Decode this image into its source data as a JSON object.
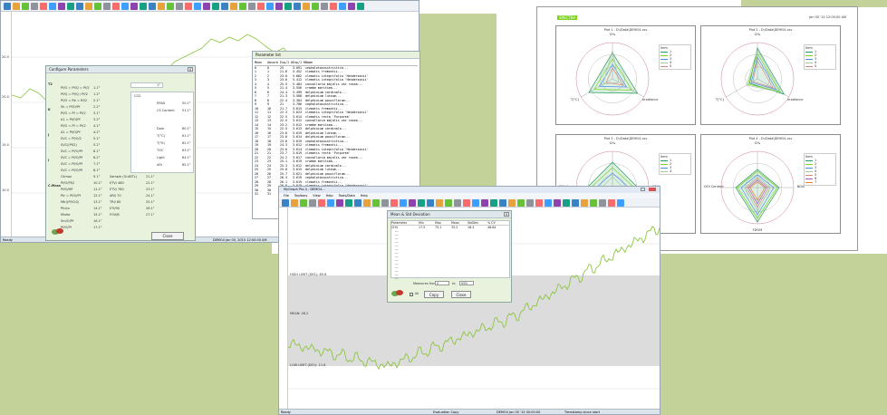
{
  "colors": {
    "background_green": "#c2d299",
    "trace_green": "#8cc63f",
    "dialog_fill": "#e9f2dd",
    "shaded_band": "#dcdcdc",
    "radar_green": "#1f9d55"
  },
  "main_window": {
    "ready_label": "Ready",
    "status_text": "DEMO4  Jan 05, 2015 12:00:00 AM",
    "y_ticks": [
      "20.0",
      "20.0",
      "15.0",
      "10.0",
      "5.0"
    ]
  },
  "config_dialog": {
    "title": "Configure Parameters",
    "close_label": "Close",
    "blank_value": "1°",
    "section_labels": [
      "T2",
      "K",
      "J",
      "I",
      "C.Mass"
    ],
    "left_rows": [
      "Pf/O = Pf/Q = Pf/2",
      "Pf/Q = Pf/Q / Pf/2",
      "Pf/O = Rk = Rf/2",
      "Sk = Pf/O/Pf",
      "Pf/O = Pf = Pf/2",
      "A1 = Pf/O/Pf",
      "Pf/O = Pf = Pf/2",
      "A1 = Pf/O/Pf",
      "SVC = Pf/O/2",
      "SVC/(Pf/2)",
      "SVC = Pf/O/Pf",
      "SVC = Pf/O/Pf",
      "SVC = Pf/O/Pf",
      "SVC = Pf/O/Pf",
      "Climax",
      "Pf/O/Pf/2",
      "Pf/O/MF",
      "Ptr = Pf/O/Pf",
      "Mtr/(Pf/O/2)",
      "Ptr/ra",
      "Mixfor",
      "Sm/O/Pf",
      "Pf/O/Pf"
    ],
    "left_values": [
      "1.1°",
      "1.2°",
      "2.1°",
      "2.2°",
      "3.1°",
      "3.2°",
      "4.1°",
      "4.2°",
      "5.1°",
      "5.2°",
      "6.1°",
      "6.2°",
      "7.1°",
      "8.1°",
      "9.1°",
      "10.1°",
      "11.1°",
      "12.1°",
      "13.1°",
      "14.1°",
      "15.1°",
      "16.1°",
      "17.1°"
    ],
    "right_top_label": "CO2",
    "right_rows": [
      "EPAD",
      "CS Content",
      "Dark",
      "T(°C)",
      "T(°K)",
      "TOC",
      "Light",
      "ARI"
    ],
    "right_values": [
      "50.1°",
      "51.1°",
      "60.1°",
      "61.1°",
      "62.1°",
      "63.1°",
      "64.1°",
      "65.1°"
    ],
    "bottom_rows": [
      "Sample (OutDTL)",
      "ETV/ 480",
      "ETV/ 780",
      "ARI/ 70",
      "TRI/ 80",
      "ETI/90",
      "FOV/B"
    ],
    "bottom_values": [
      "21.1°",
      "22.1°",
      "23.1°",
      "24.1°",
      "25.1°",
      "26.1°",
      "27.1°"
    ]
  },
  "param_list": {
    "title": "Parameter list",
    "headers": [
      "Mean",
      "Absorb",
      "Exp/1 Obj",
      "Exp/1 RGPD",
      "Name"
    ],
    "rows": [
      [
        "0",
        "0",
        "25",
        "3.091",
        "cephalotaxusstrictica..."
      ],
      [
        "1",
        "1",
        "21.6",
        "3.452",
        "clematis fremontii..."
      ],
      [
        "2",
        "2",
        "23.0",
        "5.662",
        "clematis integrifolia 'Hendersonii'"
      ],
      [
        "3",
        "3",
        "23.6",
        "5.412",
        "clematis integrifolia 'Hendersonii'"
      ],
      [
        "4",
        "4",
        "25.5",
        "5.484",
        "convallaria majalis var rosea..."
      ],
      [
        "5",
        "5",
        "21.4",
        "3.556",
        "crambe maritima..."
      ],
      [
        "6",
        "6",
        "24.4",
        "3.499",
        "delphinium cardinale..."
      ],
      [
        "7",
        "7",
        "21.3",
        "3.568",
        "delphinium luteum..."
      ],
      [
        "8",
        "8",
        "22.4",
        "3.304",
        "delphinium pauciflorum..."
      ],
      [
        "9",
        "9",
        "21",
        "3.706",
        "cephalotaxusstrictica..."
      ],
      [
        "10",
        "10",
        "21.7",
        "3.615",
        "clematis fremontii..."
      ],
      [
        "11",
        "11",
        "22.3",
        "3.623",
        "clematis integrifolia 'Hendersonii'"
      ],
      [
        "12",
        "12",
        "22.5",
        "3.614",
        "clematis recta 'Purpurea'"
      ],
      [
        "13",
        "13",
        "22.5",
        "3.612",
        "convallaria majalis var rosea..."
      ],
      [
        "14",
        "14",
        "23.2",
        "3.612",
        "crambe maritima..."
      ],
      [
        "15",
        "15",
        "22.5",
        "3.613",
        "delphinium cardinale..."
      ],
      [
        "16",
        "16",
        "23.6",
        "3.619",
        "delphinium luteum..."
      ],
      [
        "17",
        "17",
        "23.8",
        "3.614",
        "delphinium pauciflorum..."
      ],
      [
        "18",
        "18",
        "23.6",
        "3.619",
        "cephalotaxusstrictica..."
      ],
      [
        "19",
        "19",
        "24.3",
        "3.612",
        "clematis fremontii..."
      ],
      [
        "20",
        "20",
        "23.6",
        "3.614",
        "clematis integrifolia 'Hendersonii'"
      ],
      [
        "21",
        "21",
        "23.7",
        "3.619",
        "clematis recta 'Purpurea'"
      ],
      [
        "22",
        "22",
        "24.2",
        "3.617",
        "convallaria majalis var rosea..."
      ],
      [
        "23",
        "23",
        "25.1",
        "3.619",
        "crambe maritima..."
      ],
      [
        "24",
        "24",
        "25.3",
        "3.612",
        "delphinium cardinale..."
      ],
      [
        "25",
        "25",
        "25.8",
        "3.615",
        "delphinium luteum..."
      ],
      [
        "26",
        "26",
        "25.7",
        "3.621",
        "delphinium pauciflorum..."
      ],
      [
        "27",
        "27",
        "26.3",
        "3.619",
        "cephalotaxusstrictica..."
      ],
      [
        "28",
        "28",
        "26.1",
        "3.619",
        "clematis fremontii..."
      ],
      [
        "29",
        "29",
        "26.6",
        "3.619",
        "clematis integrifolia 'Hendersonii'"
      ],
      [
        "30",
        "30",
        "26.5",
        "3.613",
        "convallaria majalis var rosea..."
      ],
      [
        "31",
        "31",
        "27.3",
        "3.612",
        "crambe maritima..."
      ]
    ]
  },
  "radar_doc": {
    "badge": "SPECTRA",
    "header_right": "Jan 05 '15 12:00:00 AM",
    "charts": [
      {
        "title": "Plot 1 - D:\\Data\\DEMO4.csv",
        "labels": [
          "CH₄",
          "Irradiance",
          "T(°C)"
        ],
        "legend_title": "Item",
        "legend": [
          "1",
          "2",
          "3",
          "4",
          "5"
        ],
        "values": [
          [
            0.72,
            0.8,
            0.75
          ],
          [
            0.55,
            0.62,
            0.58
          ],
          [
            0.4,
            0.45,
            0.42
          ],
          [
            0.78,
            0.2,
            0.3
          ],
          [
            0.3,
            0.35,
            0.2
          ]
        ]
      },
      {
        "title": "Plot 2 - D:\\Data\\DEMO4.csv",
        "labels": [
          "CH₄",
          "Irradiance",
          "T(°C)"
        ],
        "legend_title": "Item",
        "legend": [
          "1",
          "2",
          "3",
          "4",
          "5"
        ],
        "values": [
          [
            0.85,
            0.85,
            0.25
          ],
          [
            0.7,
            0.7,
            0.3
          ],
          [
            0.6,
            0.6,
            0.2
          ],
          [
            0.8,
            0.75,
            0.35
          ],
          [
            0.5,
            0.5,
            0.15
          ]
        ]
      },
      {
        "title": "Plot 3 - D:\\Data\\DEMO4.csv",
        "labels": [
          "CH₄",
          "NDVI",
          "FDOM",
          "DOI Content"
        ],
        "legend_title": "Item",
        "legend": [
          "1",
          "2",
          "3",
          "4"
        ],
        "values": [
          [
            0.7,
            0.7,
            0.7,
            0.7
          ],
          [
            0.55,
            0.6,
            0.55,
            0.6
          ],
          [
            0.4,
            0.45,
            0.4,
            0.45
          ],
          [
            0.3,
            0.3,
            0.3,
            0.3
          ]
        ]
      },
      {
        "title": "Plot 4 - D:\\Data\\DEMO4.csv",
        "labels": [
          "CH₄",
          "NDVI",
          "FDOM",
          "DOI Content"
        ],
        "legend_title": "Item",
        "legend": [
          "1",
          "2",
          "3",
          "4",
          "5",
          "6",
          "7"
        ],
        "values": [
          [
            0.5,
            0.6,
            0.95,
            0.6
          ],
          [
            0.45,
            0.55,
            0.85,
            0.55
          ],
          [
            0.35,
            0.45,
            0.75,
            0.45
          ],
          [
            0.3,
            0.35,
            0.65,
            0.35
          ],
          [
            0.25,
            0.3,
            0.55,
            0.3
          ],
          [
            0.2,
            0.25,
            0.45,
            0.25
          ],
          [
            0.15,
            0.2,
            0.35,
            0.2
          ]
        ]
      }
    ]
  },
  "second_window": {
    "title": "MyGraph Pro 4 - DEMO4...",
    "menu": [
      "File",
      "Toolbars",
      "View",
      "Help",
      "Tools/Data",
      "Help"
    ],
    "band_labels": [
      "HIGH LIMIT (DE1): 85.6",
      "MEAN: 48.2",
      "LOW LIMIT (DE1): 11.6"
    ],
    "y_ticks": [
      "100",
      "80",
      "60",
      "40",
      "20"
    ],
    "x_ticks": [
      "0",
      "200",
      "400",
      "600",
      "800",
      "1000"
    ],
    "status_ready": "Ready",
    "status_mid": "Evaluation Copy",
    "status_file": "DEMO4  Jan 05 '15 00:00:00",
    "status_right": "Timestamp since start"
  },
  "stats_dialog": {
    "title": "Mean & Std Deviation",
    "headers": [
      "Parameter",
      "Min",
      "Max",
      "Mean",
      "StdDev",
      "% CV"
    ],
    "row": [
      "CH4",
      "17.5",
      "75.1",
      "35.2",
      "16.4",
      "46.64"
    ],
    "blank_rows": [
      "---",
      "---",
      "---",
      "---",
      "---",
      "---",
      "---",
      "---",
      "---",
      "---",
      "---",
      "---",
      "---",
      "---"
    ],
    "measures_label": "Measures from",
    "from_value": "0",
    "to_label": "to",
    "to_value": "999",
    "checkbox_label": "All",
    "copy_label": "Copy",
    "close_label": "Close"
  }
}
